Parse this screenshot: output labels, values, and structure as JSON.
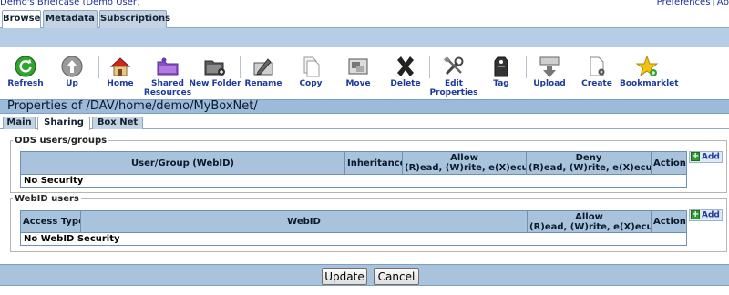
{
  "header": {
    "breadcrumb": "Demo's Briefcase (Demo User)",
    "links": [
      "Preferences",
      "Ab"
    ],
    "separator": "|"
  },
  "main_tabs": [
    {
      "label": "Browse",
      "active": true
    },
    {
      "label": "Metadata",
      "active": false
    },
    {
      "label": "Subscriptions",
      "active": false
    }
  ],
  "toolbar": {
    "refresh": "Refresh",
    "up": "Up",
    "home": "Home",
    "shared_line1": "Shared",
    "shared_line2": "Resources",
    "new_folder": "New Folder",
    "rename": "Rename",
    "copy": "Copy",
    "move": "Move",
    "delete": "Delete",
    "edit_line1": "Edit",
    "edit_line2": "Properties",
    "tag": "Tag",
    "upload": "Upload",
    "create": "Create",
    "bookmarklet": "Bookmarklet"
  },
  "properties_title": "Properties of /DAV/home/demo/MyBoxNet/",
  "sub_tabs": [
    {
      "label": "Main",
      "active": false
    },
    {
      "label": "Sharing",
      "active": true
    },
    {
      "label": "Box Net",
      "active": false
    }
  ],
  "ods_section": {
    "legend": "ODS users/groups",
    "headers": {
      "user_group": "User/Group (WebID)",
      "inheritance": "Inheritance",
      "allow_line1": "Allow",
      "allow_line2": "(R)ead, (W)rite, e(X)ecute",
      "deny_line1": "Deny",
      "deny_line2": "(R)ead, (W)rite, e(X)ecute",
      "action": "Action"
    },
    "empty_text": "No Security",
    "add_label": "Add"
  },
  "webid_section": {
    "legend": "WebID users",
    "headers": {
      "access_type": "Access Type",
      "webid": "WebID",
      "allow_line1": "Allow",
      "allow_line2": "(R)ead, (W)rite, e(X)ecute",
      "action": "Action"
    },
    "empty_text": "No WebID Security",
    "add_label": "Add"
  },
  "buttons": {
    "update": "Update",
    "cancel": "Cancel"
  },
  "colors": {
    "band": "#b6cde6",
    "header_cell": "#a9c3dd",
    "link": "#1d3a9e"
  }
}
